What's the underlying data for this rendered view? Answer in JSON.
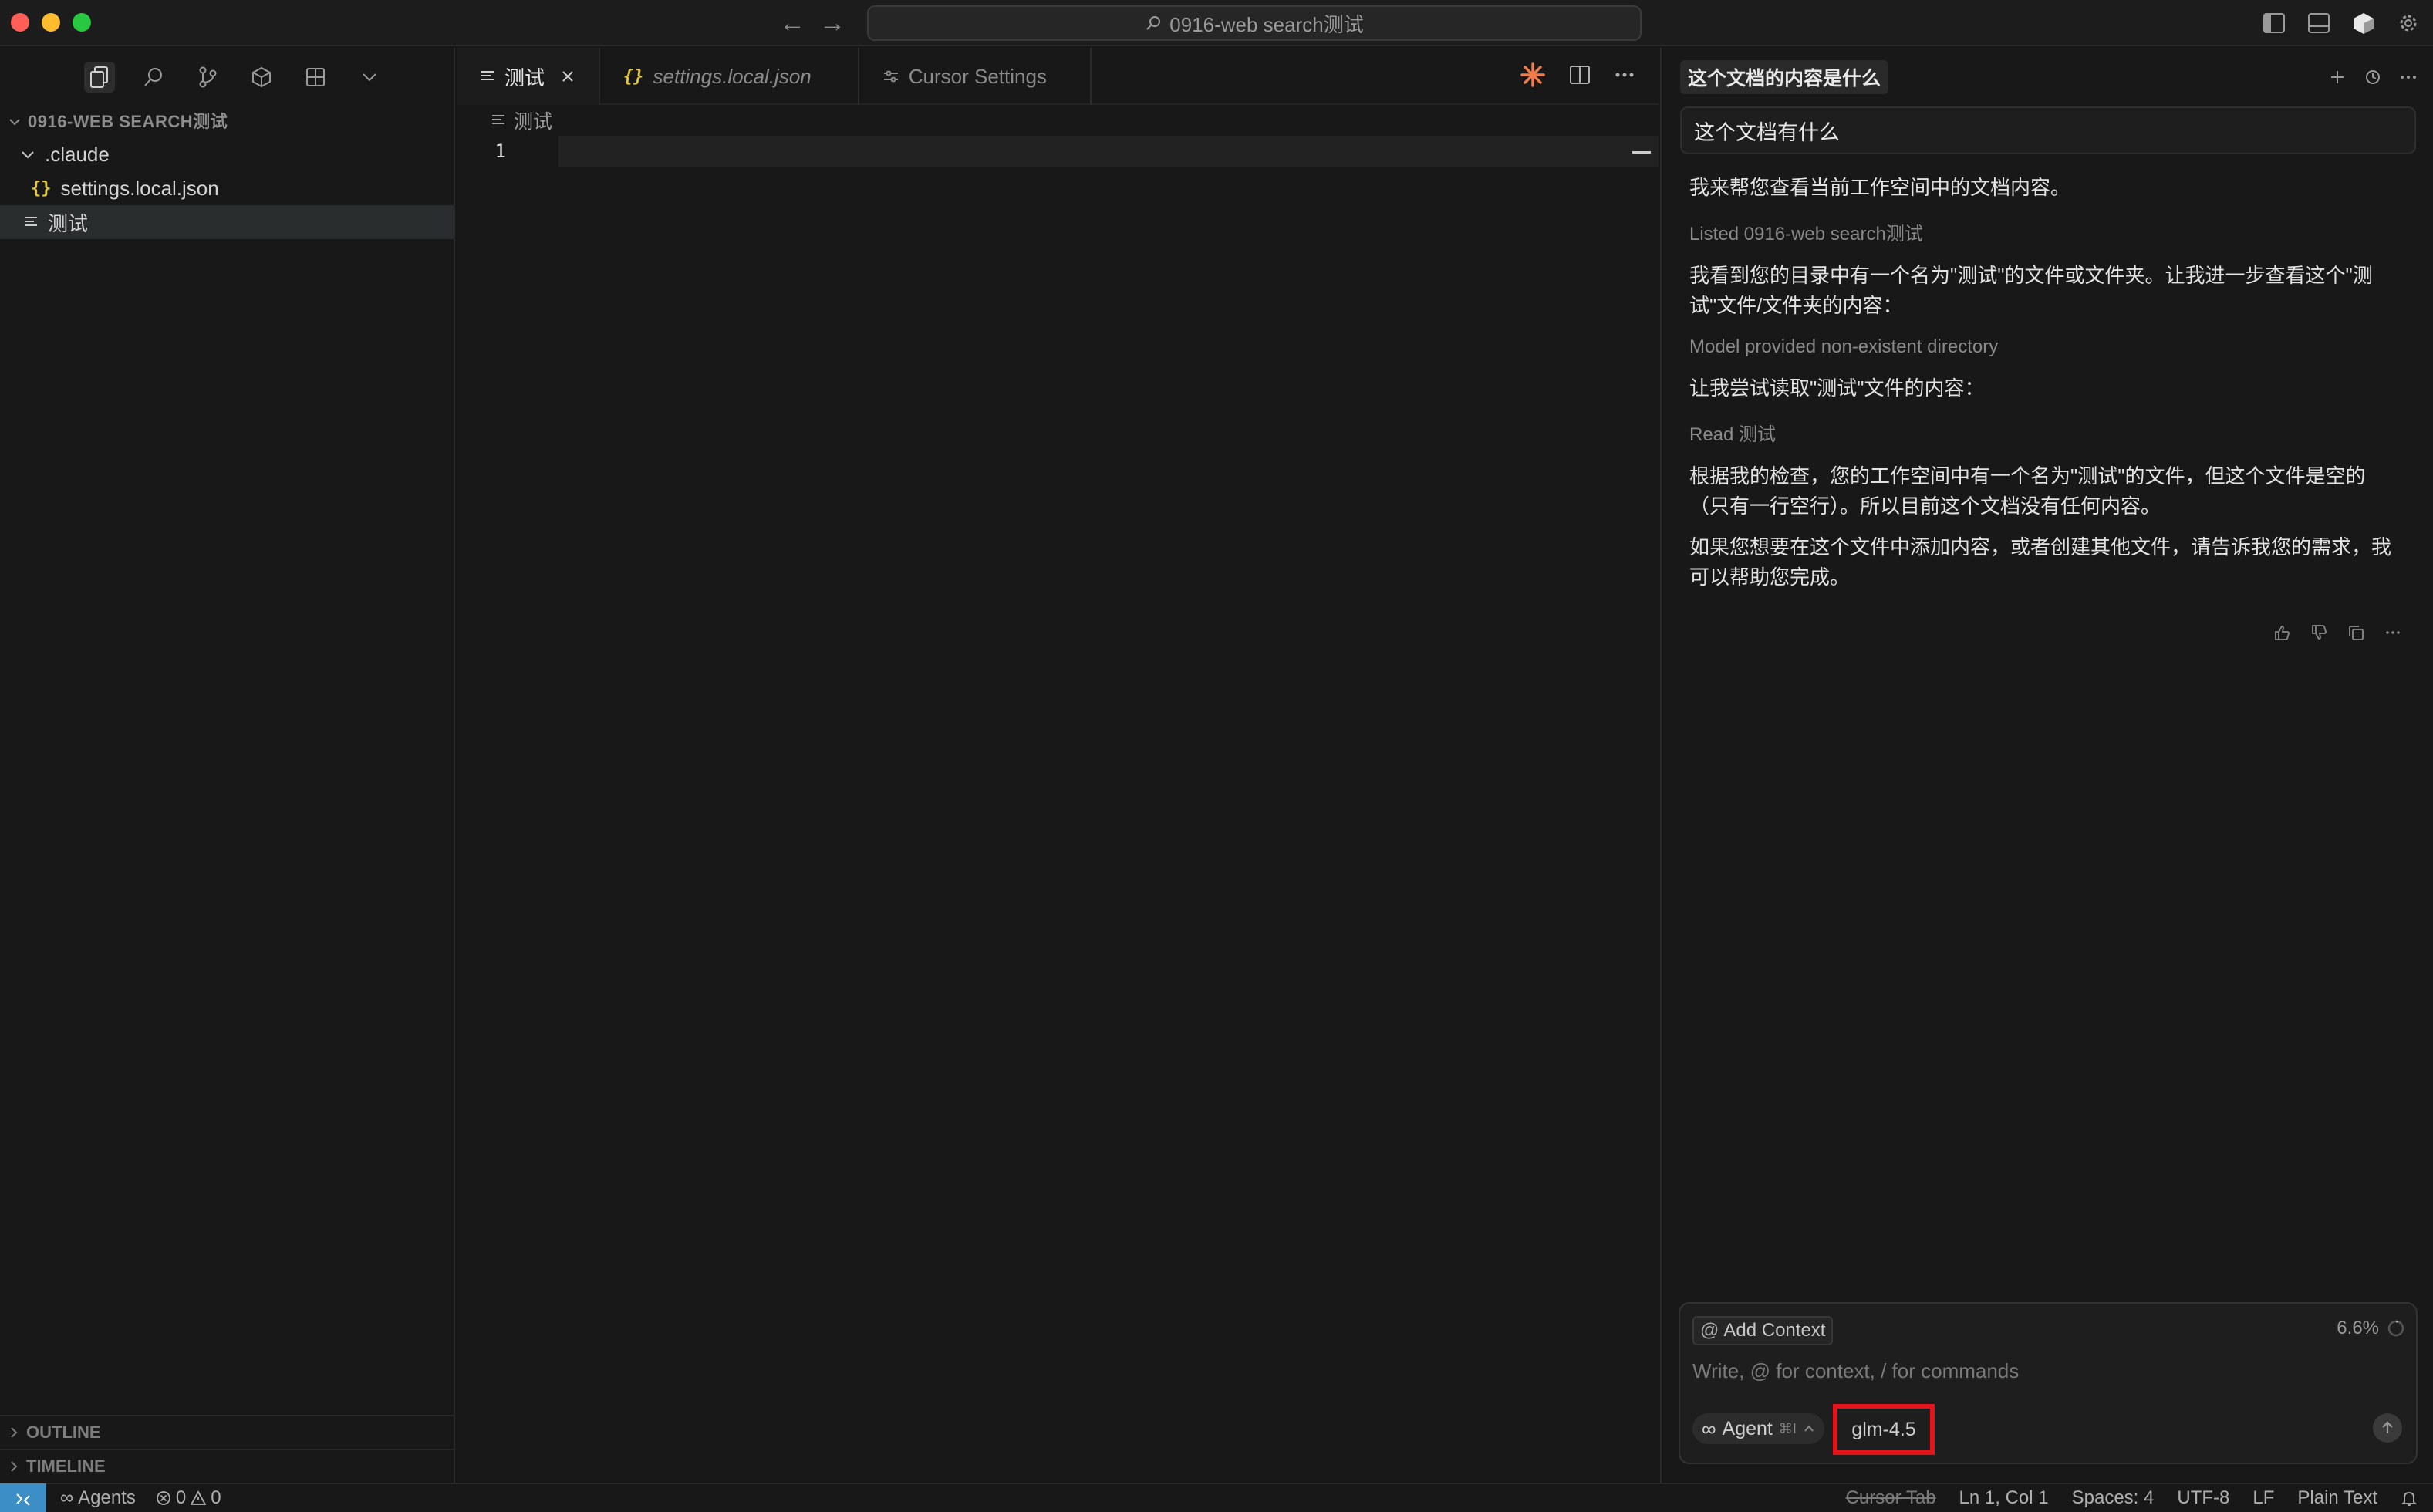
{
  "titlebar": {
    "search_text": "0916-web search测试"
  },
  "sidebar": {
    "root_label": "0916-WEB SEARCH测试",
    "items": [
      {
        "label": ".claude"
      },
      {
        "label": "settings.local.json",
        "icon_text": "{}"
      },
      {
        "label": "测试"
      }
    ],
    "outline_label": "OUTLINE",
    "timeline_label": "TIMELINE"
  },
  "editor": {
    "tabs": [
      {
        "label": "测试"
      },
      {
        "label": "settings.local.json",
        "icon_text": "{}"
      },
      {
        "label": "Cursor Settings"
      }
    ],
    "breadcrumb": "测试",
    "line_number": "1"
  },
  "chat": {
    "tab_title": "这个文档的内容是什么",
    "user_message": "这个文档有什么",
    "messages": {
      "m1": "我来帮您查看当前工作空间中的文档内容。",
      "t1": "Listed 0916-web search测试",
      "m2": "我看到您的目录中有一个名为\"测试\"的文件或文件夹。让我进一步查看这个\"测试\"文件/文件夹的内容：",
      "t2": "Model provided non-existent directory",
      "m3": "让我尝试读取\"测试\"文件的内容：",
      "t3": "Read 测试",
      "m4": "根据我的检查，您的工作空间中有一个名为\"测试\"的文件，但这个文件是空的（只有一行空行）。所以目前这个文档没有任何内容。",
      "m5": "如果您想要在这个文件中添加内容，或者创建其他文件，请告诉我您的需求，我可以帮助您完成。"
    },
    "composer": {
      "add_context": "Add Context",
      "usage": "6.6%",
      "placeholder": "Write, @ for context, / for commands",
      "agent_label": "Agent",
      "agent_shortcut": "⌘I",
      "model": "glm-4.5"
    }
  },
  "statusbar": {
    "agents": "Agents",
    "errors": "0",
    "warnings": "0",
    "cursor_tab": "Cursor Tab",
    "position": "Ln 1, Col 1",
    "spaces": "Spaces: 4",
    "encoding": "UTF-8",
    "eol": "LF",
    "language": "Plain Text"
  },
  "colors": {
    "highlight_box": "#e5141b",
    "accent_orange": "#f07c4a",
    "remote_blue": "#3c8fc6"
  }
}
